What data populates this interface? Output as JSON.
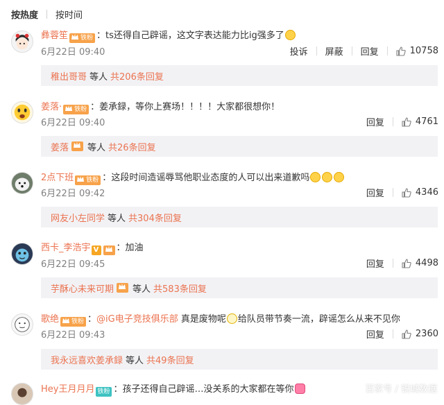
{
  "tabs": {
    "hot": "按热度",
    "time": "按时间"
  },
  "labels": {
    "report": "投诉",
    "block": "屏蔽",
    "reply": "回复",
    "sep_colon": "：",
    "and_others": "等人",
    "fan_badge": "铁粉",
    "vip_mark": "V"
  },
  "colors": {
    "username": "#eb7350",
    "badge": "#f7a24a",
    "badge_green": "#3ec2c2",
    "reply_bg": "#f2f2f5"
  },
  "comments": [
    {
      "user": "彝蓉笙",
      "text": "ts还得自己辟谣，这文字表达能力比ig强多了",
      "time": "6月22日 09:40",
      "likes": "10758",
      "replies": {
        "user": "稚出哥哥",
        "count": "共206条回复"
      }
    },
    {
      "user": "姜落·",
      "text": "姜承録，等你上赛场！！！！大家都很想你！",
      "time": "6月22日 09:40",
      "likes": "4761",
      "replies": {
        "user": "姜落",
        "count": "共26条回复"
      }
    },
    {
      "user": "2点下班",
      "text": "这段时间造谣辱骂他职业态度的人可以出来道歉吗",
      "time": "6月22日 09:42",
      "likes": "4346",
      "replies": {
        "user": "网友小左同学",
        "count": "共304条回复"
      }
    },
    {
      "user": "西卡_李浩宇",
      "text": "加油",
      "time": "6月22日 09:45",
      "likes": "4498",
      "replies": {
        "user": "芋酥心未来可期",
        "count": "共583条回复"
      }
    },
    {
      "user": "歌绝",
      "mention": "@iG电子竞技俱乐部",
      "text": " 真是废物呢",
      "text2": "给队员带节奏一流，辟谣怎么从来不见你",
      "time": "6月22日 09:43",
      "likes": "2360",
      "replies": {
        "user": "我永远喜欢姜承録",
        "count": "共49条回复"
      }
    },
    {
      "user": "Hey王月月月",
      "text": "孩子还得自己辟谣…没关系的大家都在等你"
    }
  ],
  "watermark": "百家号 / 锐城数据"
}
